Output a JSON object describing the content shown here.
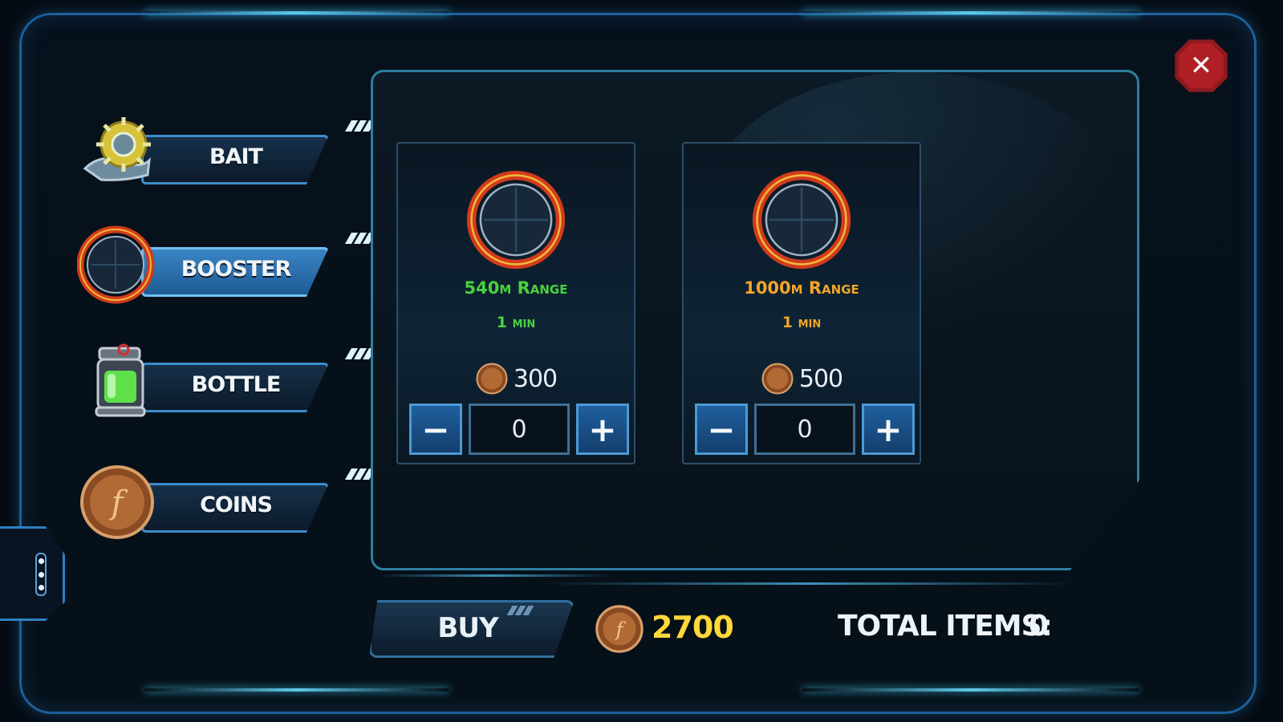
{
  "close": {
    "label": "✕",
    "icon": "close-icon"
  },
  "categories": [
    {
      "label": "BAIT",
      "icon": "bait-icon",
      "active": false
    },
    {
      "label": "BOOSTER",
      "icon": "booster-radar-icon",
      "active": true
    },
    {
      "label": "BOTTLE",
      "icon": "bottle-icon",
      "active": false
    },
    {
      "label": "COINS",
      "icon": "coin-icon",
      "active": false
    }
  ],
  "items": [
    {
      "icon": "booster-radar-icon",
      "range": "540m Range",
      "duration": "1 min",
      "price": "300",
      "quantity": "0",
      "accent": "#49d23f",
      "minus": "−",
      "plus": "+"
    },
    {
      "icon": "booster-radar-icon",
      "range": "1000m Range",
      "duration": "1 min",
      "price": "500",
      "quantity": "0",
      "accent": "#f1a52a",
      "minus": "−",
      "plus": "+"
    }
  ],
  "footer": {
    "buy_label": "BUY",
    "balance": "2700",
    "total_label": "TOTAL ITEMS:",
    "total_value": "0"
  },
  "colors": {
    "frame": "#1d5f9a",
    "panel_border": "#2f7ea0",
    "balance": "#ffd83a",
    "close": "#b01f25"
  }
}
